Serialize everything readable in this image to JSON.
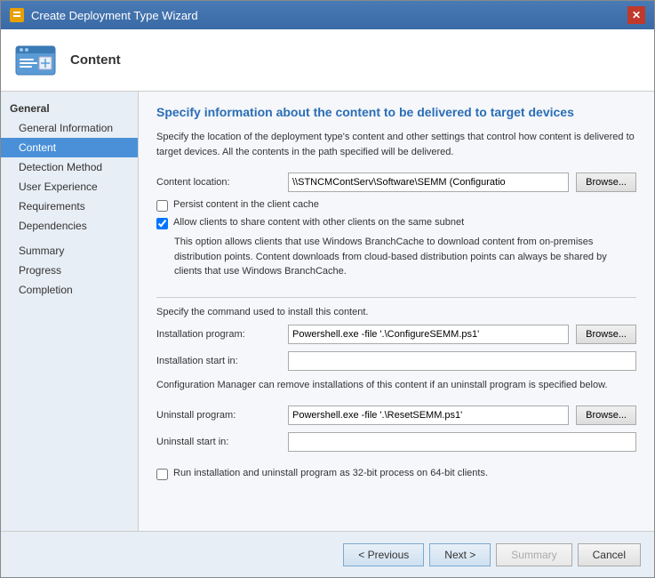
{
  "window": {
    "title": "Create Deployment Type Wizard",
    "close_label": "✕"
  },
  "header": {
    "title": "Content"
  },
  "sidebar": {
    "sections": [
      {
        "label": "General",
        "items": [
          {
            "id": "general-information",
            "label": "General Information",
            "active": false
          },
          {
            "id": "content",
            "label": "Content",
            "active": true
          },
          {
            "id": "detection-method",
            "label": "Detection Method",
            "active": false
          },
          {
            "id": "user-experience",
            "label": "User Experience",
            "active": false
          },
          {
            "id": "requirements",
            "label": "Requirements",
            "active": false
          },
          {
            "id": "dependencies",
            "label": "Dependencies",
            "active": false
          }
        ]
      },
      {
        "label": "",
        "items": [
          {
            "id": "summary",
            "label": "Summary",
            "active": false
          },
          {
            "id": "progress",
            "label": "Progress",
            "active": false
          },
          {
            "id": "completion",
            "label": "Completion",
            "active": false
          }
        ]
      }
    ]
  },
  "content": {
    "title": "Specify information about the content to be delivered to target devices",
    "description": "Specify the location of the deployment type's content and other settings that control how content is delivered to target devices. All the contents in the path specified will be delivered.",
    "content_location_label": "Content location:",
    "content_location_value": "\\\\STNCMContServ\\Software\\SEMM (Configuratio",
    "browse_label": "Browse...",
    "persist_cache_label": "Persist content in the client cache",
    "persist_cache_checked": false,
    "allow_share_label": "Allow clients to share content with other clients on the same subnet",
    "allow_share_checked": true,
    "branch_cache_info": "This option allows clients that use Windows BranchCache to download content from on-premises distribution points. Content downloads from cloud-based distribution points can always be shared by clients that use Windows BranchCache.",
    "separator1": true,
    "install_command_desc": "Specify the command used to install this content.",
    "installation_program_label": "Installation program:",
    "installation_program_value": "Powershell.exe -file '.\\ConfigureSEMM.ps1'",
    "installation_start_label": "Installation start in:",
    "installation_start_value": "",
    "uninstall_note": "Configuration Manager can remove installations of this content if an uninstall program is specified below.",
    "uninstall_program_label": "Uninstall program:",
    "uninstall_program_value": "Powershell.exe -file '.\\ResetSEMM.ps1'",
    "uninstall_start_label": "Uninstall start in:",
    "uninstall_start_value": "",
    "run_32bit_label": "Run installation and uninstall program as 32-bit process on 64-bit clients.",
    "run_32bit_checked": false
  },
  "footer": {
    "previous_label": "< Previous",
    "next_label": "Next >",
    "summary_label": "Summary",
    "cancel_label": "Cancel"
  }
}
